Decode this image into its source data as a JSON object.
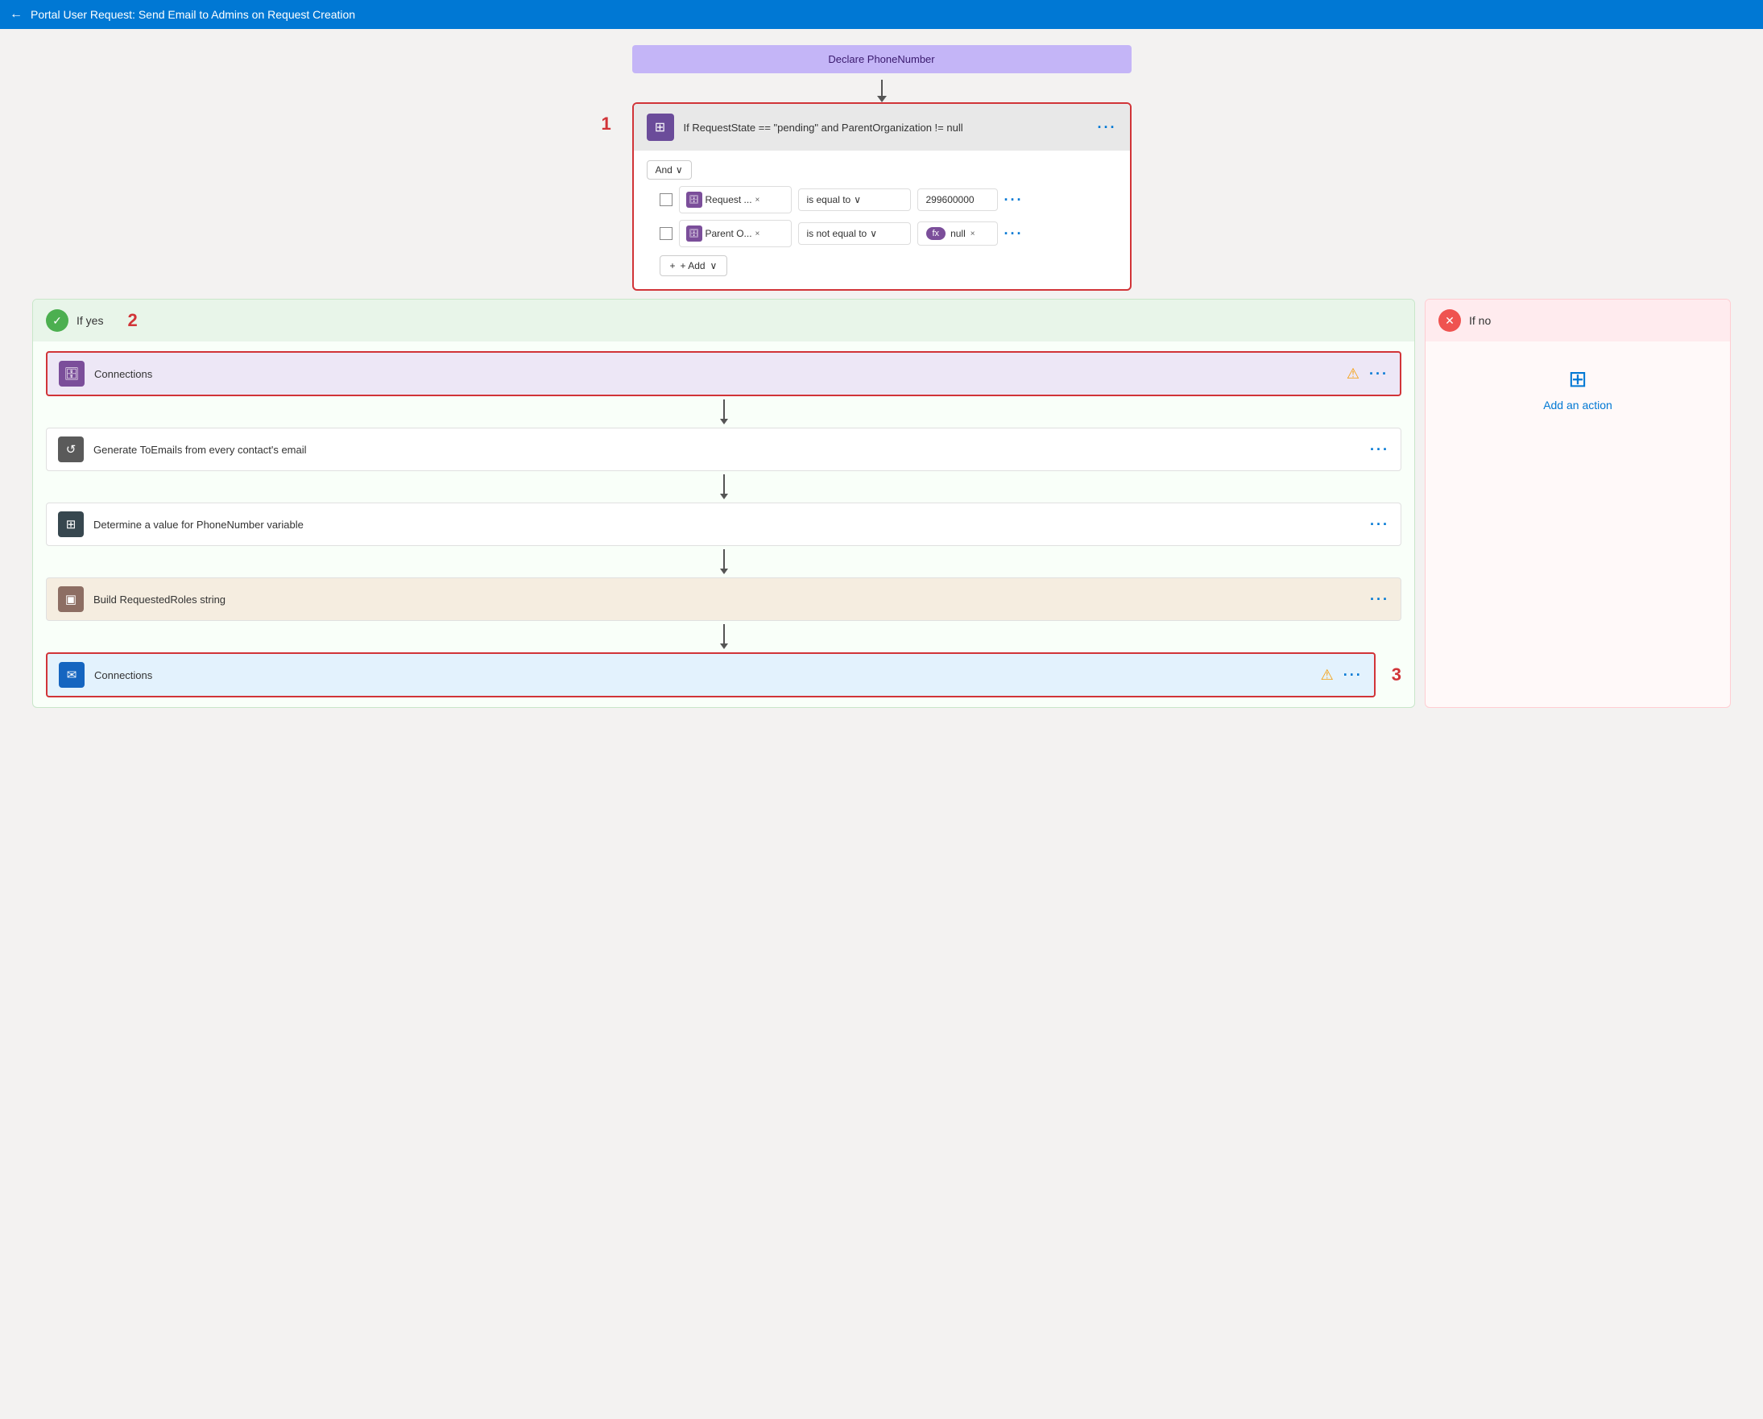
{
  "topbar": {
    "title": "Portal User Request: Send Email to Admins on Request Creation",
    "back_label": "←"
  },
  "declare_block": {
    "label": "Declare PhoneNumber"
  },
  "condition_block": {
    "step_number": "1",
    "title": "If RequestState == \"pending\" and ParentOrganization != null",
    "icon": "⊞",
    "more": "···",
    "and_label": "And",
    "row1": {
      "field_label": "Request ...",
      "operator": "is equal to",
      "value": "299600000"
    },
    "row2": {
      "field_label": "Parent O...",
      "operator": "is not equal to",
      "value_chip": "null"
    },
    "add_label": "+ Add"
  },
  "branch_yes": {
    "header_label": "If yes",
    "step_number": "2",
    "actions": [
      {
        "id": "connections1",
        "label": "Connections",
        "icon_type": "purple",
        "has_warning": true,
        "has_border": true
      },
      {
        "id": "generate",
        "label": "Generate ToEmails from every contact's email",
        "icon_type": "gray",
        "has_warning": false,
        "has_border": false
      },
      {
        "id": "determine",
        "label": "Determine a value for PhoneNumber variable",
        "icon_type": "dark",
        "has_warning": false,
        "has_border": false
      },
      {
        "id": "build",
        "label": "Build RequestedRoles string",
        "icon_type": "brown",
        "has_warning": false,
        "has_border": false
      },
      {
        "id": "connections2",
        "label": "Connections",
        "icon_type": "blue",
        "has_warning": true,
        "has_border": true
      }
    ]
  },
  "branch_no": {
    "header_label": "If no",
    "add_action_label": "Add an action",
    "step_number": "3"
  },
  "icons": {
    "database": "🗄",
    "loop": "↺",
    "condition": "⊞",
    "build": "▣",
    "email": "✉",
    "check": "✓",
    "x": "✕",
    "plus": "+",
    "chevron_down": "∨",
    "ellipsis": "···",
    "fx": "fx",
    "warning": "⚠"
  }
}
